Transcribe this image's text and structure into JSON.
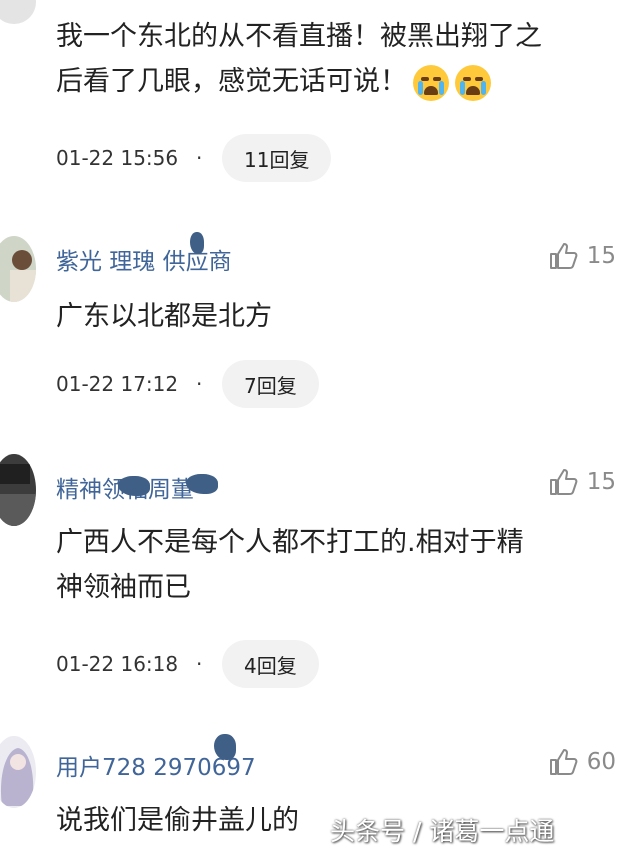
{
  "comments": [
    {
      "text_lines": [
        "我一个东北的从不看直播！被黑出翔了之",
        "后看了几眼，感觉无话可说！"
      ],
      "emojis": [
        "crying-face-icon",
        "crying-face-icon"
      ],
      "time": "01-22 15:56",
      "replies": "11回复"
    },
    {
      "username": "紫光 理瑰 供应商",
      "likes": "15",
      "text_lines": [
        "广东以北都是北方"
      ],
      "time": "01-22 17:12",
      "replies": "7回复"
    },
    {
      "username": "精神领袖周董",
      "likes": "15",
      "text_lines": [
        "广西人不是每个人都不打工的.相对于精",
        "神领袖而已"
      ],
      "time": "01-22 16:18",
      "replies": "4回复"
    },
    {
      "username": "用户728 2970697",
      "likes": "60",
      "text_lines": [
        "说我们是偷井盖儿的"
      ]
    }
  ],
  "separator": "·",
  "watermark": "头条号 / 诸葛一点通",
  "colors": {
    "username": "#406599",
    "pill": "#f2f2f2",
    "like": "#8a8a8a"
  }
}
